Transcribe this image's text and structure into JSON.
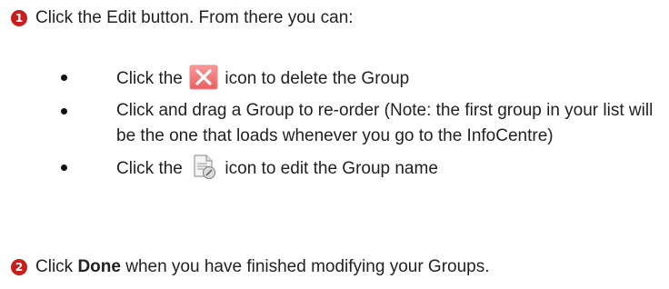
{
  "step1": {
    "number": "1",
    "text": "Click the Edit button. From there you can:"
  },
  "bullets": [
    {
      "before": "Click the",
      "icon": "delete-x-icon",
      "after": "icon to delete the Group"
    },
    {
      "text": "Click and drag a Group to re-order (Note: the first group in your list will be the one that loads whenever you go to the InfoCentre)"
    },
    {
      "before": "Click the",
      "icon": "edit-document-icon",
      "after": "icon to edit the Group name"
    }
  ],
  "step2": {
    "number": "2",
    "prefix": "Click",
    "bold": "Done",
    "suffix": "when you have finished modifying your Groups."
  },
  "colors": {
    "step_badge": "#c81e1e",
    "delete_icon": "#f07070",
    "text": "#222222"
  }
}
